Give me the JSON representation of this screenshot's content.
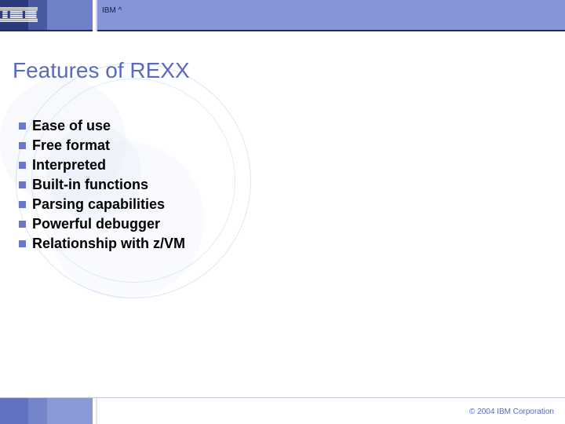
{
  "header": {
    "label": "IBM ^"
  },
  "title": "Features of REXX",
  "bullets": [
    "Ease of use",
    "Free format",
    "Interpreted",
    "Built-in functions",
    "Parsing capabilities",
    "Powerful debugger",
    "Relationship with z/VM"
  ],
  "footer": {
    "copyright": "© 2004 IBM Corporation"
  },
  "colors": {
    "accent": "#6a79c7",
    "title": "#5a6abf"
  }
}
